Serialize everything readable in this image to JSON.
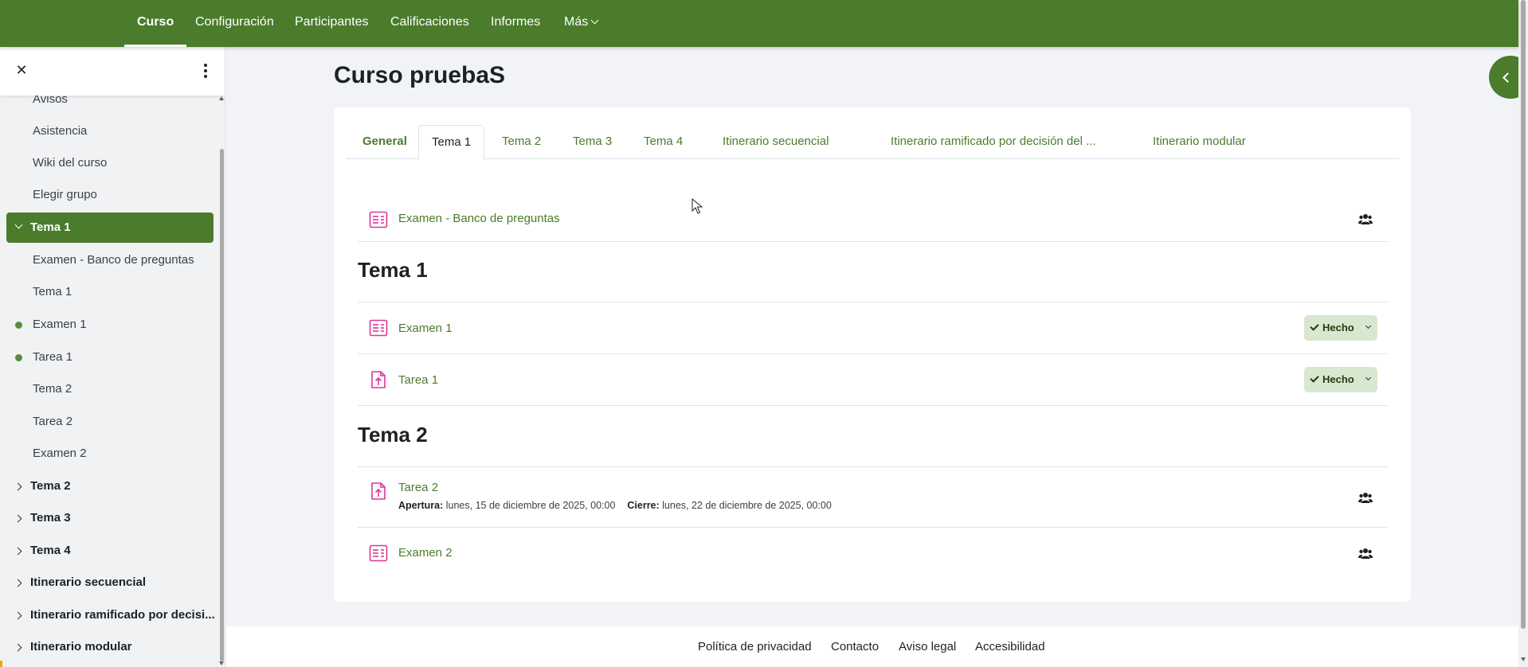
{
  "topnav": {
    "items": [
      {
        "label": "Curso",
        "active": true
      },
      {
        "label": "Configuración"
      },
      {
        "label": "Participantes"
      },
      {
        "label": "Calificaciones"
      },
      {
        "label": "Informes"
      },
      {
        "label": "Más"
      }
    ]
  },
  "drawer": {
    "items": [
      {
        "label": "Avisos"
      },
      {
        "label": "Asistencia"
      },
      {
        "label": "Wiki del curso"
      },
      {
        "label": "Elegir grupo"
      },
      {
        "label": "Tema 1"
      },
      {
        "label": "Examen - Banco de preguntas"
      },
      {
        "label": "Tema 1"
      },
      {
        "label": "Examen 1"
      },
      {
        "label": "Tarea 1"
      },
      {
        "label": "Tema 2"
      },
      {
        "label": "Tarea 2"
      },
      {
        "label": "Examen 2"
      },
      {
        "label": "Tema 2"
      },
      {
        "label": "Tema 3"
      },
      {
        "label": "Tema 4"
      },
      {
        "label": "Itinerario secuencial"
      },
      {
        "label": "Itinerario ramificado por decisi..."
      },
      {
        "label": "Itinerario modular"
      }
    ]
  },
  "main": {
    "title": "Curso pruebaS",
    "tabs": [
      {
        "label": "General"
      },
      {
        "label": "Tema 1"
      },
      {
        "label": "Tema 2"
      },
      {
        "label": "Tema 3"
      },
      {
        "label": "Tema 4"
      },
      {
        "label": "Itinerario secuencial"
      },
      {
        "label": "Itinerario ramificado por decisión del ..."
      },
      {
        "label": "Itinerario modular"
      }
    ],
    "top_activity": {
      "name": "Examen - Banco de preguntas"
    },
    "sections": [
      {
        "title": "Tema 1",
        "activities": [
          {
            "name": "Examen 1",
            "status": "Hecho"
          },
          {
            "name": "Tarea 1",
            "status": "Hecho"
          }
        ]
      },
      {
        "title": "Tema 2",
        "activities": [
          {
            "name": "Tarea 2",
            "open_label": "Apertura:",
            "open_value": "lunes, 15 de diciembre de 2025, 00:00",
            "close_label": "Cierre:",
            "close_value": "lunes, 22 de diciembre de 2025, 00:00"
          },
          {
            "name": "Examen 2"
          }
        ]
      }
    ]
  },
  "footer": {
    "links": [
      {
        "label": "Política de privacidad"
      },
      {
        "label": "Contacto"
      },
      {
        "label": "Aviso legal"
      },
      {
        "label": "Accesibilidad"
      }
    ]
  },
  "colors": {
    "brand": "#4a7c2b",
    "activity_icon": "#e0339a",
    "done_bg": "#d8e7cf"
  },
  "icons": {
    "quiz": "quiz-icon",
    "assign": "assignment-upload-icon",
    "group": "group-icon",
    "close": "close-icon",
    "menu": "kebab-menu-icon",
    "drawer_toggle": "chevron-left-icon"
  }
}
